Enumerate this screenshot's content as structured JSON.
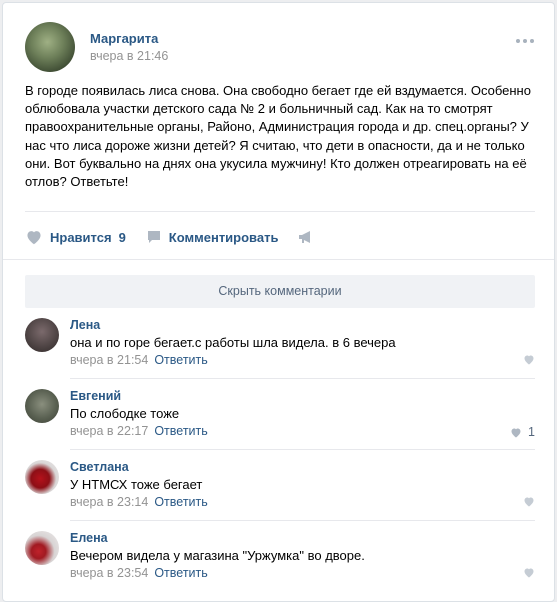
{
  "post": {
    "author": "Маргарита",
    "time": "вчера в 21:46",
    "text": "В городе появилась лиса снова. Она свободно бегает где ей вздумается. Особенно облюбовала участки детского сада № 2 и больничный сад. Как на то смотрят правоохранительные органы, Районо, Администрация города и др. спец.органы? У нас что лиса дороже жизни детей? Я считаю, что дети в опасности, да и не только они. Вот буквально на днях она укусила мужчину! Кто должен отреагировать на её отлов? Ответьте!"
  },
  "actions": {
    "like_label": "Нравится",
    "like_count": "9",
    "comment_label": "Комментировать"
  },
  "hide_comments_label": "Скрыть комментарии",
  "reply_label": "Ответить",
  "comments": [
    {
      "name": "Лена",
      "text": "она и по горе бегает.с работы шла видела. в 6 вечера",
      "time": "вчера в 21:54",
      "likes": ""
    },
    {
      "name": "Евгений",
      "text": "По слободке тоже",
      "time": "вчера в 22:17",
      "likes": "1"
    },
    {
      "name": "Светлана",
      "text": "У НТМСХ тоже бегает",
      "time": "вчера в 23:14",
      "likes": ""
    },
    {
      "name": "Елена",
      "text": "Вечером видела у магазина \"Уржумка\" во дворе.",
      "time": "вчера в 23:54",
      "likes": ""
    }
  ],
  "colors": {
    "link": "#2a5885",
    "meta": "#939393",
    "icon": "#aeb7c2",
    "divider": "#e7e8ec"
  }
}
